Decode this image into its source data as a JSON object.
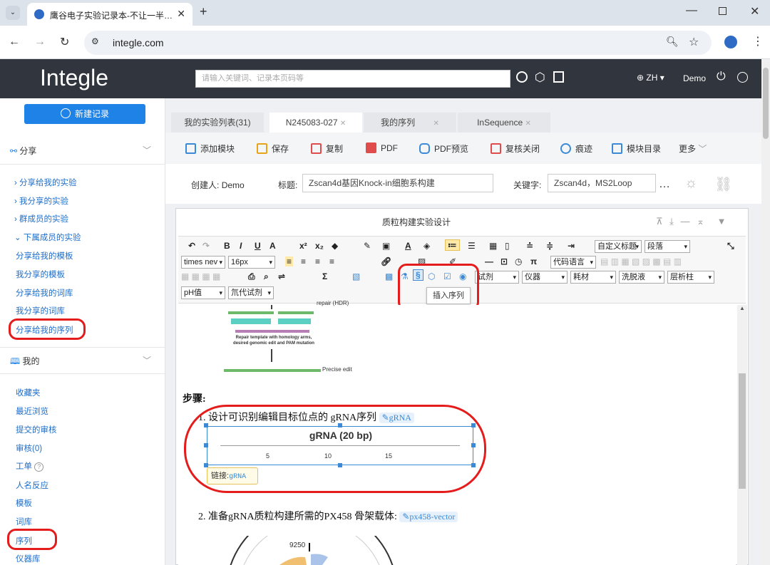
{
  "browser": {
    "tab_title": "鹰谷电子实验记录本-不让一半…",
    "url": "integle.com"
  },
  "app": {
    "logo": "Integle",
    "search_placeholder": "请输入关键词、记录本页码等",
    "lang": "ZH ▾",
    "user": "Demo"
  },
  "sidebar": {
    "new_record": "新建记录",
    "share_head": "分享",
    "share_groups": [
      "分享给我的实验",
      "我分享的实验",
      "群成员的实验",
      "下属成员的实验"
    ],
    "share_items": [
      "分享给我的模板",
      "我分享的模板",
      "分享给我的词库",
      "我分享的词库",
      "分享给我的序列"
    ],
    "mine_head": "我的",
    "mine_items": [
      "收藏夹",
      "最近浏览",
      "提交的审核",
      "审核(0)",
      "工单",
      "人名反应",
      "模板",
      "词库",
      "序列",
      "仪器库"
    ]
  },
  "tabs": [
    "我的实验列表(31)",
    "N245083-027",
    "我的序列",
    "InSequence"
  ],
  "toolbar": [
    "添加模块",
    "保存",
    "复制",
    "PDF",
    "PDF预览",
    "复核关闭",
    "痕迹",
    "模块目录",
    "更多"
  ],
  "meta": {
    "creator_label": "创建人:",
    "creator": "Demo",
    "title_label": "标题:",
    "title": "Zscan4d基因Knock-in细胞系构建",
    "keywords_label": "关键字:",
    "keywords": "Zscan4d，MS2Loop"
  },
  "editor": {
    "module_title": "质粒构建实验设计",
    "font": "times nev",
    "size": "16px",
    "code_lang": "代码语言",
    "custom_title": "自定义标题",
    "paragraph": "段落",
    "selects": [
      "试剂",
      "仪器",
      "耗材",
      "洗脱液",
      "层析柱"
    ],
    "selects2": [
      "pH值",
      "氘代试剂"
    ],
    "tooltip": "插入序列"
  },
  "doc": {
    "repair_label": "repair (HDR)",
    "template_label": "Repair template with homology arms, desired genomic edit and PAM mutation",
    "precise_label": "Precise edit",
    "steps_label": "步骤:",
    "step1": "1. 设计可识别编辑目标位点的 gRNA序列",
    "step1_chip": "gRNA",
    "seq_title": "gRNA (20 bp)",
    "ticks": [
      "5",
      "10",
      "15"
    ],
    "link_label": "链接:",
    "link_value": "gRNA",
    "step2": "2. 准备gRNA质粒构建所需的PX458 骨架载体:",
    "step2_chip": "px458-vector",
    "plasmid_pos": "9250"
  }
}
